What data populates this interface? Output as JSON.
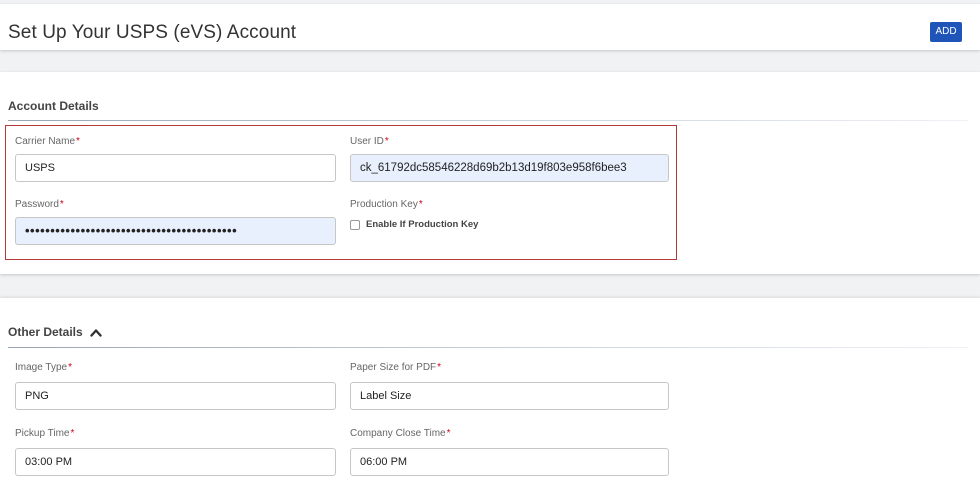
{
  "header": {
    "title": "Set Up Your USPS (eVS) Account",
    "add_label": "ADD"
  },
  "account": {
    "section_title": "Account Details",
    "carrier_name": {
      "label": "Carrier Name",
      "required": "*",
      "value": "USPS"
    },
    "user_id": {
      "label": "User ID",
      "required": "*",
      "value": "ck_61792dc58546228d69b2b13d19f803e958f6bee3"
    },
    "password": {
      "label": "Password",
      "required": "*",
      "value": "••••••••••••••••••••••••••••••••••••••••••"
    },
    "production_key": {
      "label": "Production Key",
      "required": "*",
      "checkbox_label": "Enable If Production Key",
      "checked": false
    }
  },
  "other": {
    "section_title": "Other Details",
    "toggle_icon": "chevron-up-icon",
    "image_type": {
      "label": "Image Type",
      "required": "*",
      "value": "PNG"
    },
    "paper_size": {
      "label": "Paper Size for PDF",
      "required": "*",
      "value": "Label Size"
    },
    "pickup_time": {
      "label": "Pickup Time",
      "required": "*",
      "value": "03:00 PM"
    },
    "company_close_time": {
      "label": "Company Close Time",
      "required": "*",
      "value": "06:00 PM"
    }
  },
  "colors": {
    "accent": "#1f55b8",
    "required": "#d0021b",
    "highlight_border": "#b33a3a",
    "autofill_bg": "#e8f0fe"
  }
}
